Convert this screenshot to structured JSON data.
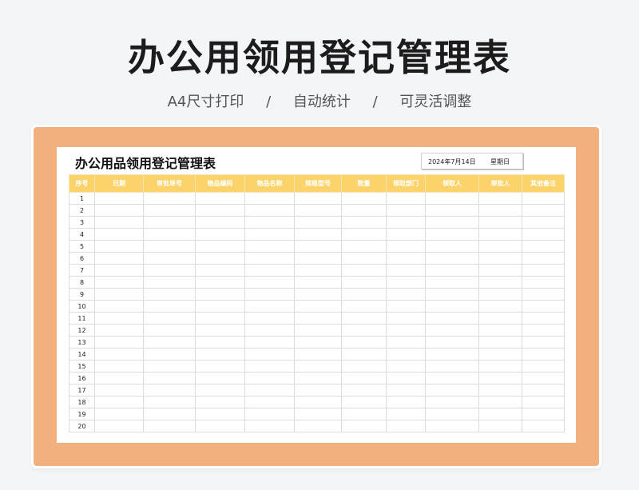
{
  "header": {
    "title": "办公用领用登记管理表",
    "features": [
      "A4尺寸打印",
      "自动统计",
      "可灵活调整"
    ],
    "separator": "/"
  },
  "sheet": {
    "title": "办公用品领用登记管理表",
    "date": "2024年7月14日",
    "weekday": "星期日",
    "columns": [
      "序号",
      "日期",
      "审批单号",
      "物品编码",
      "物品名称",
      "规格型号",
      "数量",
      "领取部门",
      "领取人",
      "审批人",
      "其他备注"
    ],
    "rows": [
      "1",
      "2",
      "3",
      "4",
      "5",
      "6",
      "7",
      "8",
      "9",
      "10",
      "11",
      "12",
      "13",
      "14",
      "15",
      "16",
      "17",
      "18",
      "19",
      "20"
    ]
  },
  "colors": {
    "frame": "#f3b07f",
    "header_fill": "#fbd36a",
    "header_text": "#ffffff",
    "background": "#f3f5f8"
  }
}
